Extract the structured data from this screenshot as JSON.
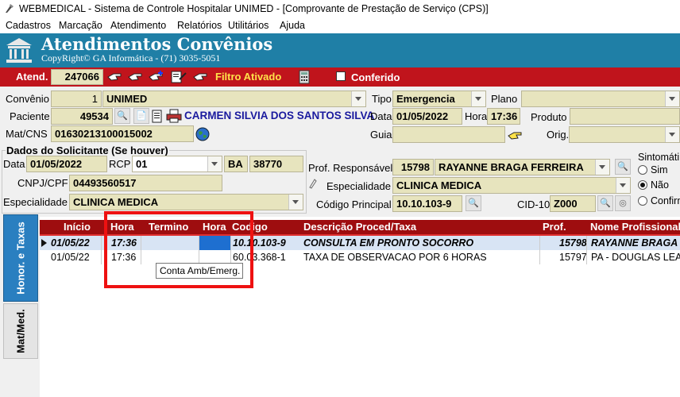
{
  "window": {
    "title": "WEBMEDICAL - Sistema de Controle Hospitalar UNIMED - [Comprovante de Prestação de Serviço  (CPS)]"
  },
  "menu": [
    "Cadastros",
    "Marcação",
    "Atendimento",
    "Relatórios",
    "Utilitários",
    "Ajuda"
  ],
  "banner": {
    "title": "Atendimentos Convênios",
    "subtitle": "CopyRight© GA Informática - (71) 3035-5051"
  },
  "toolbar": {
    "atend_label": "Atend.",
    "atend_value": "247066",
    "filter_status": "Filtro Ativado",
    "conferido_label": "Conferido",
    "conferido_checked": false
  },
  "form": {
    "convenio_label": "Convênio",
    "convenio_code": "1",
    "convenio_name": "UNIMED",
    "tipo_label": "Tipo",
    "tipo_value": "Emergencia",
    "plano_label": "Plano",
    "plano_value": "",
    "paciente_label": "Paciente",
    "paciente_code": "49534",
    "paciente_name": "CARMEN SILVIA DOS SANTOS SILVA",
    "data_label": "Data",
    "data_value": "01/05/2022",
    "hora_label": "Hora",
    "hora_value": "17:36",
    "produto_label": "Produto",
    "produto_value": "",
    "matcns_label": "Mat/CNS",
    "matcns_value": "01630213100015002",
    "guia_label": "Guia",
    "guia_value": "",
    "orig_label": "Orig.",
    "orig_value": ""
  },
  "solicitante": {
    "title": "Dados do Solicitante (Se houver)",
    "data_label": "Data",
    "data_value": "01/05/2022",
    "rcp_label": "RCP",
    "rcp_value": "01",
    "uf_value": "BA",
    "num_value": "38770",
    "cnpj_label": "CNPJ/CPF",
    "cnpj_value": "04493560517",
    "especialidade_label": "Especialidade",
    "especialidade_value": "CLINICA MEDICA"
  },
  "responsavel": {
    "prof_label": "Prof. Responsável",
    "prof_code": "15798",
    "prof_name": "RAYANNE BRAGA FERREIRA",
    "especialidade_label": "Especialidade",
    "especialidade_value": "CLINICA MEDICA",
    "codigo_label": "Código Principal",
    "codigo_value": "10.10.103-9",
    "cid_label": "CID-10",
    "cid_value": "Z000"
  },
  "sintomatico": {
    "title": "Sintomáti",
    "options": [
      "Sim",
      "Não",
      "Confirm"
    ],
    "selected": "Não"
  },
  "tabs": [
    "Honor. e Taxas",
    "Mat/Med."
  ],
  "grid": {
    "headers": [
      "Início",
      "Hora",
      "Termino",
      "Hora",
      "Codigo",
      "Descrição Proced/Taxa",
      "Prof.",
      "Nome Profissional"
    ],
    "rows": [
      {
        "inicio": "01/05/22",
        "hora": "17:36",
        "termino": "",
        "hora2": "",
        "codigo": "10.10.103-9",
        "descricao": "CONSULTA EM PRONTO SOCORRO",
        "prof": "15798",
        "nome": "RAYANNE BRAGA F"
      },
      {
        "inicio": "01/05/22",
        "hora": "17:36",
        "termino": "",
        "hora2": "",
        "codigo": "60.03.368-1",
        "descricao": "TAXA DE OBSERVACAO POR 6 HORAS",
        "prof": "15797",
        "nome": "PA - DOUGLAS LEAN"
      }
    ]
  },
  "tooltip": "Conta Amb/Emerg.",
  "colors": {
    "banner": "#1f7fa6",
    "redbar": "#c0141c",
    "grid_header": "#9e0d0f",
    "field_bg": "#e7e4be",
    "highlight": "#ee1111"
  }
}
